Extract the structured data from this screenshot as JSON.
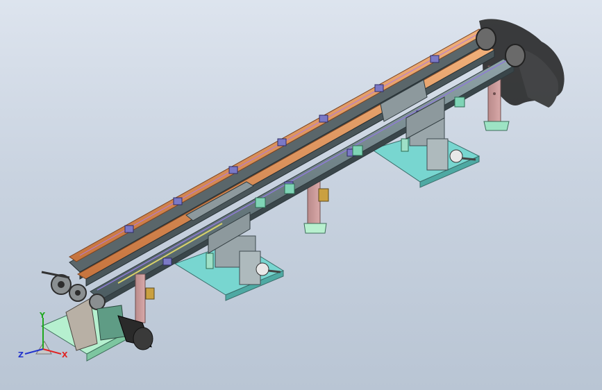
{
  "view": {
    "background_top": "#dde4ee",
    "background_bottom": "#b9c5d4"
  },
  "model": {
    "frame_color": "#4f5a5e",
    "belt_color": "#e39a63",
    "rail_color": "#6b7f86",
    "leg_color": "#c99a9a",
    "base_color": "#78d6d0",
    "base_plate_color": "#b6f0cf",
    "motor_color": "#2a2a2a",
    "bracket_color": "#7b79c6",
    "sensor_color": "#7fd4b6"
  },
  "triad": {
    "x_label": "X",
    "y_label": "Y",
    "z_label": "Z",
    "x_color": "#e02424",
    "y_color": "#1fa81f",
    "z_color": "#2233cc"
  }
}
